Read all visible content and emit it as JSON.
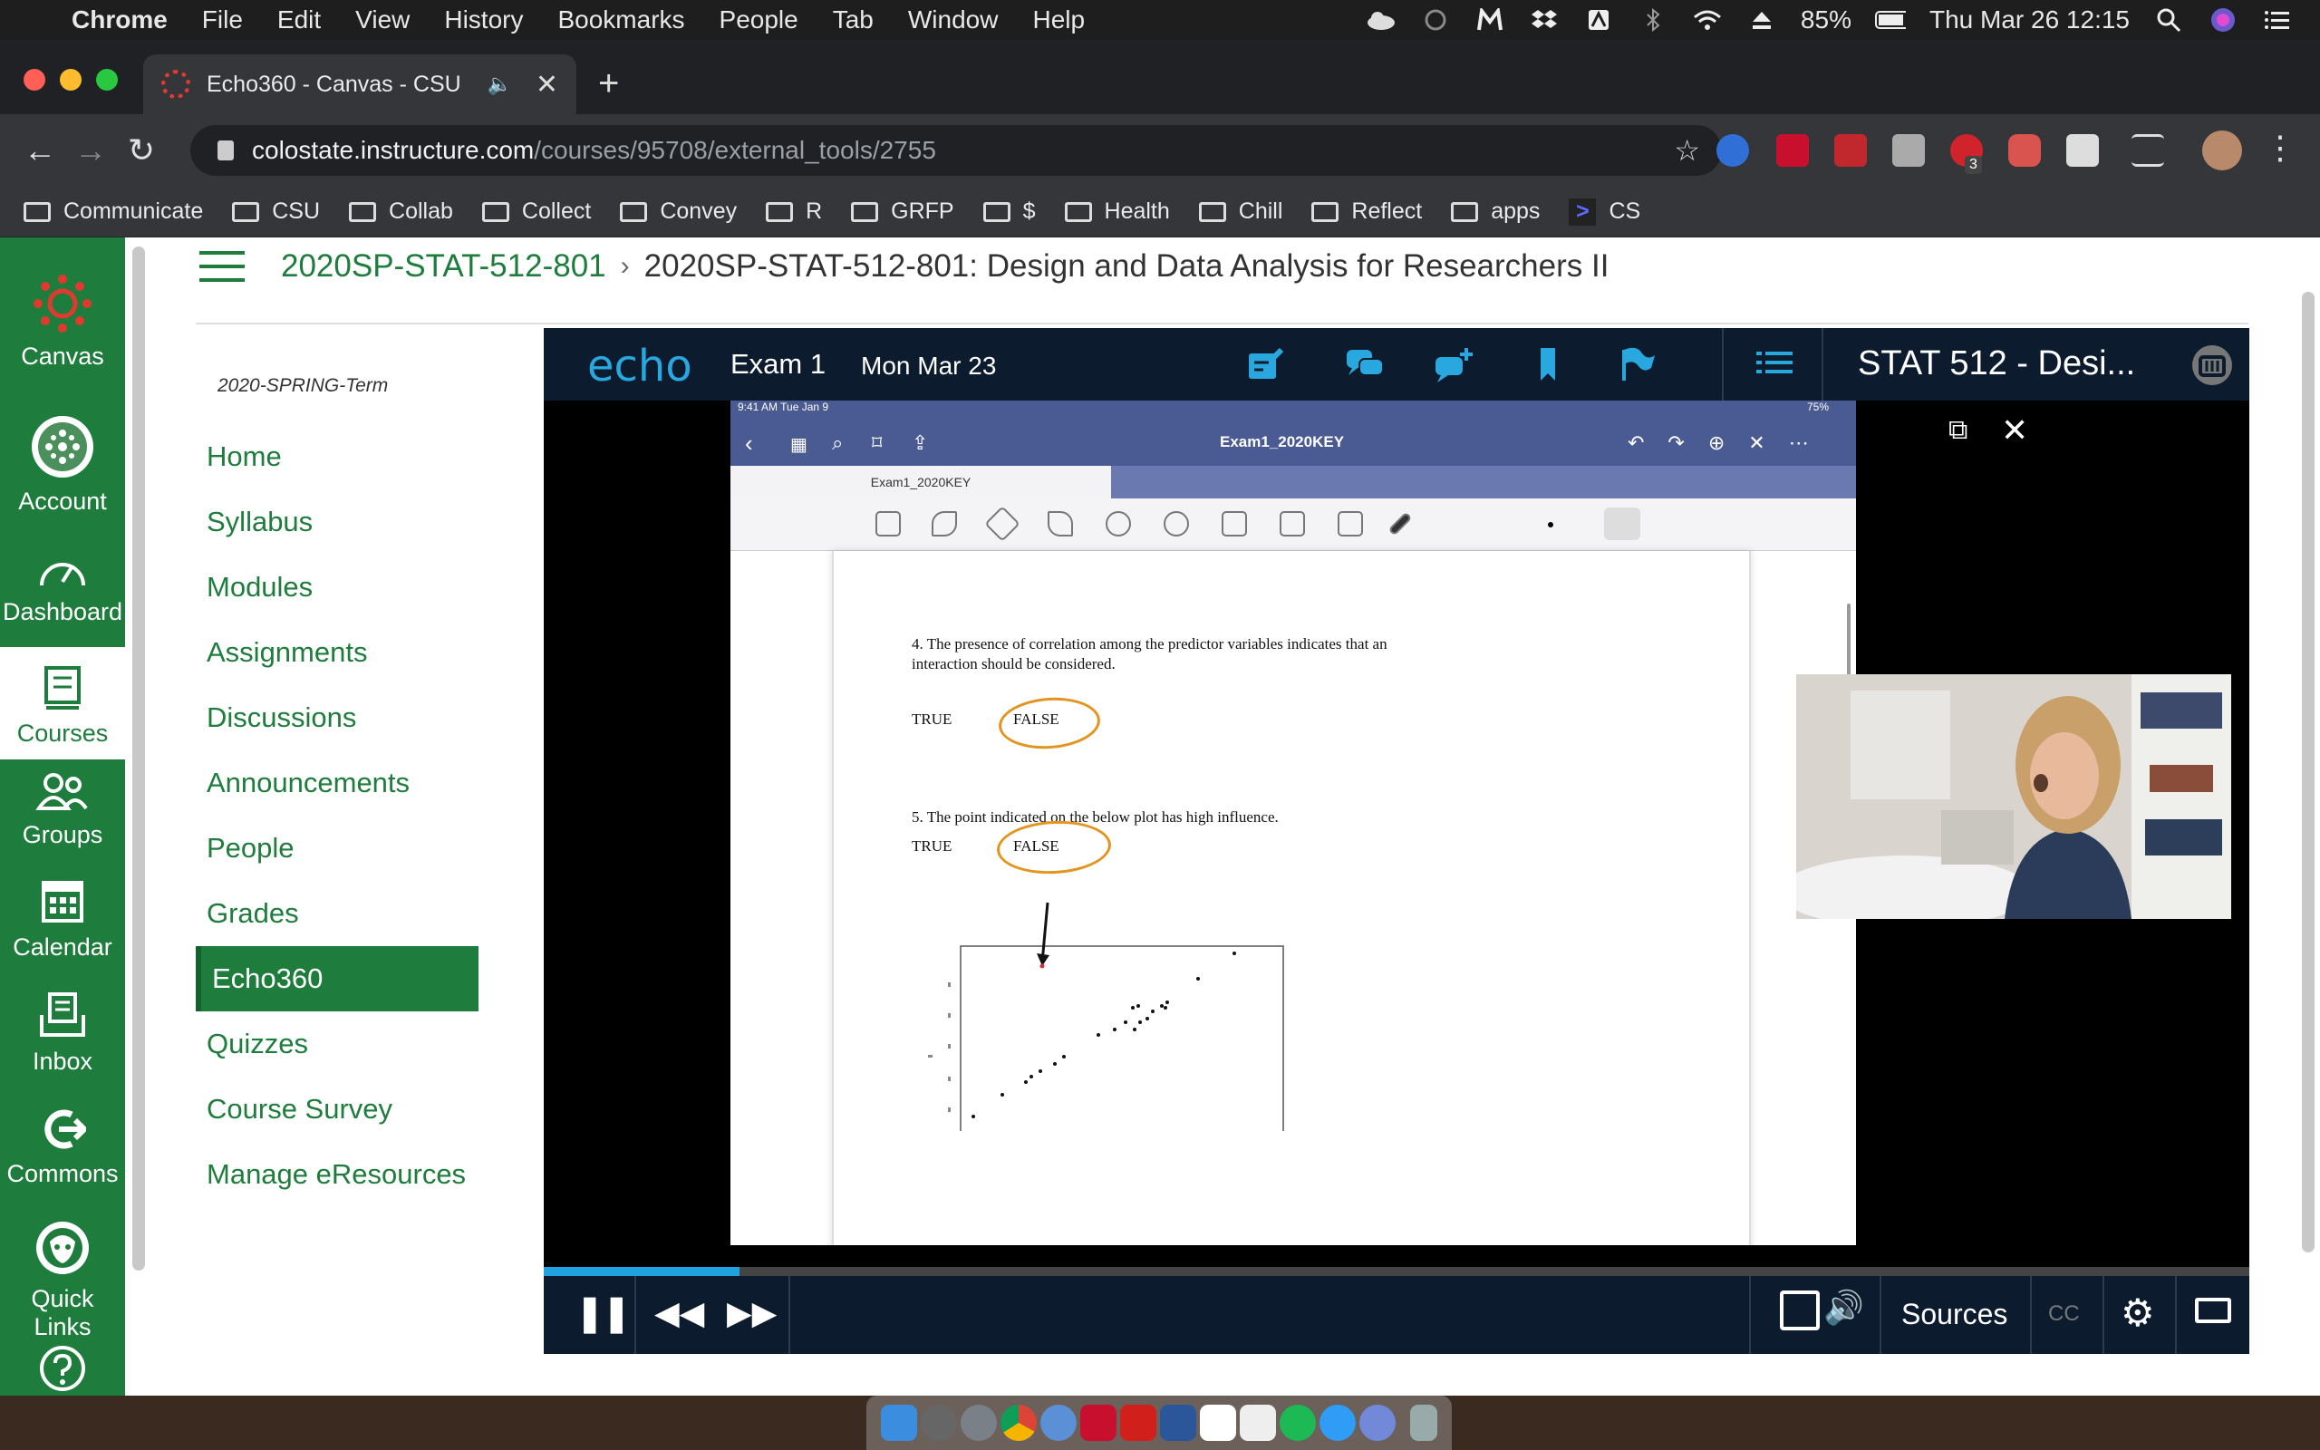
{
  "menubar": {
    "app": "Chrome",
    "items": [
      "File",
      "Edit",
      "View",
      "History",
      "Bookmarks",
      "People",
      "Tab",
      "Window",
      "Help"
    ],
    "battery": "85%",
    "clock": "Thu Mar 26  12:15"
  },
  "browser": {
    "tab_title": "Echo360 - Canvas - CSU",
    "url_domain": "colostate.instructure.com",
    "url_path": "/courses/95708/external_tools/2755",
    "ext_badge": "3"
  },
  "bookmarks": [
    "Communicate",
    "CSU",
    "Collab",
    "Collect",
    "Convey",
    "R",
    "GRFP",
    "$",
    "Health",
    "Chill",
    "Reflect",
    "apps"
  ],
  "bookmark_cs": "CS",
  "global_nav": [
    {
      "label": "Canvas",
      "icon": "canvas-logo-icon"
    },
    {
      "label": "Account",
      "icon": "account-icon"
    },
    {
      "label": "Dashboard",
      "icon": "dashboard-icon"
    },
    {
      "label": "Courses",
      "icon": "courses-icon"
    },
    {
      "label": "Groups",
      "icon": "groups-icon"
    },
    {
      "label": "Calendar",
      "icon": "calendar-icon"
    },
    {
      "label": "Inbox",
      "icon": "inbox-icon"
    },
    {
      "label": "Commons",
      "icon": "commons-icon"
    },
    {
      "label": "Quick Links",
      "icon": "quick-links-icon"
    }
  ],
  "breadcrumb": {
    "course_code": "2020SP-STAT-512-801",
    "page_title": "2020SP-STAT-512-801: Design and Data Analysis for Researchers II"
  },
  "term": "2020-SPRING-Term",
  "course_nav": [
    "Home",
    "Syllabus",
    "Modules",
    "Assignments",
    "Discussions",
    "Announcements",
    "People",
    "Grades",
    "Echo360",
    "Quizzes",
    "Course Survey",
    "Manage eResources"
  ],
  "course_nav_active": "Echo360",
  "echo": {
    "logo": "echo",
    "lesson_title": "Exam 1",
    "lesson_date": "Mon Mar 23",
    "course_title": "STAT 512 - Desi...",
    "progress_fraction": 0.115,
    "sources_label": "Sources",
    "cc_label": "CC"
  },
  "ipad": {
    "status_time": "9:41 AM   Tue Jan 9",
    "battery": "75%",
    "doc_title": "Exam1_2020KEY",
    "tab1": "Exam1_2020KEY"
  },
  "exam": {
    "q4_text": "4.  The presence of correlation among the predictor variables indicates that an interaction should be considered.",
    "q4_true": "TRUE",
    "q4_false": "FALSE",
    "q5_text": "5.  The point indicated on the below plot has high influence.",
    "q5_true": "TRUE",
    "q5_false": "FALSE"
  },
  "colors": {
    "canvas_green": "#1e7d3c",
    "echo_navy": "#0c1c2e",
    "echo_blue": "#29a8e0",
    "annotation_orange": "#e2941e"
  }
}
